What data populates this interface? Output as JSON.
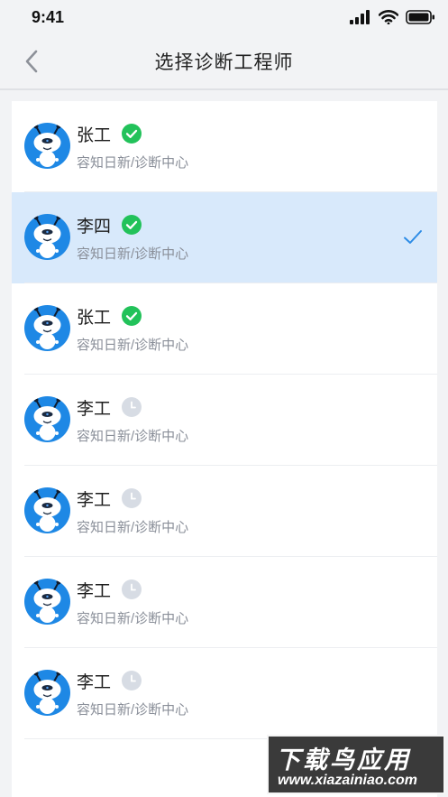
{
  "status_bar": {
    "time": "9:41"
  },
  "header": {
    "title": "选择诊断工程师"
  },
  "engineers": [
    {
      "name": "张工",
      "org": "容知日新/诊断中心",
      "status": "online",
      "selected": false
    },
    {
      "name": "李四",
      "org": "容知日新/诊断中心",
      "status": "online",
      "selected": true
    },
    {
      "name": "张工",
      "org": "容知日新/诊断中心",
      "status": "online",
      "selected": false
    },
    {
      "name": "李工",
      "org": "容知日新/诊断中心",
      "status": "pending",
      "selected": false
    },
    {
      "name": "李工",
      "org": "容知日新/诊断中心",
      "status": "pending",
      "selected": false
    },
    {
      "name": "李工",
      "org": "容知日新/诊断中心",
      "status": "pending",
      "selected": false
    },
    {
      "name": "李工",
      "org": "容知日新/诊断中心",
      "status": "pending",
      "selected": false
    }
  ],
  "icons": {
    "back": "chevron-left-icon",
    "online_badge": "check-circle-icon",
    "pending_badge": "clock-icon",
    "selected": "checkmark-icon",
    "avatar": "robot-mascot-icon"
  },
  "colors": {
    "accent": "#1e88e5",
    "online": "#22c25a",
    "pending": "#d7dce4",
    "selected_row": "#d8e9fb",
    "check": "#2d8ce6"
  },
  "watermark": {
    "main": "下载鸟应用",
    "sub": "www.xiazainiao.com"
  }
}
